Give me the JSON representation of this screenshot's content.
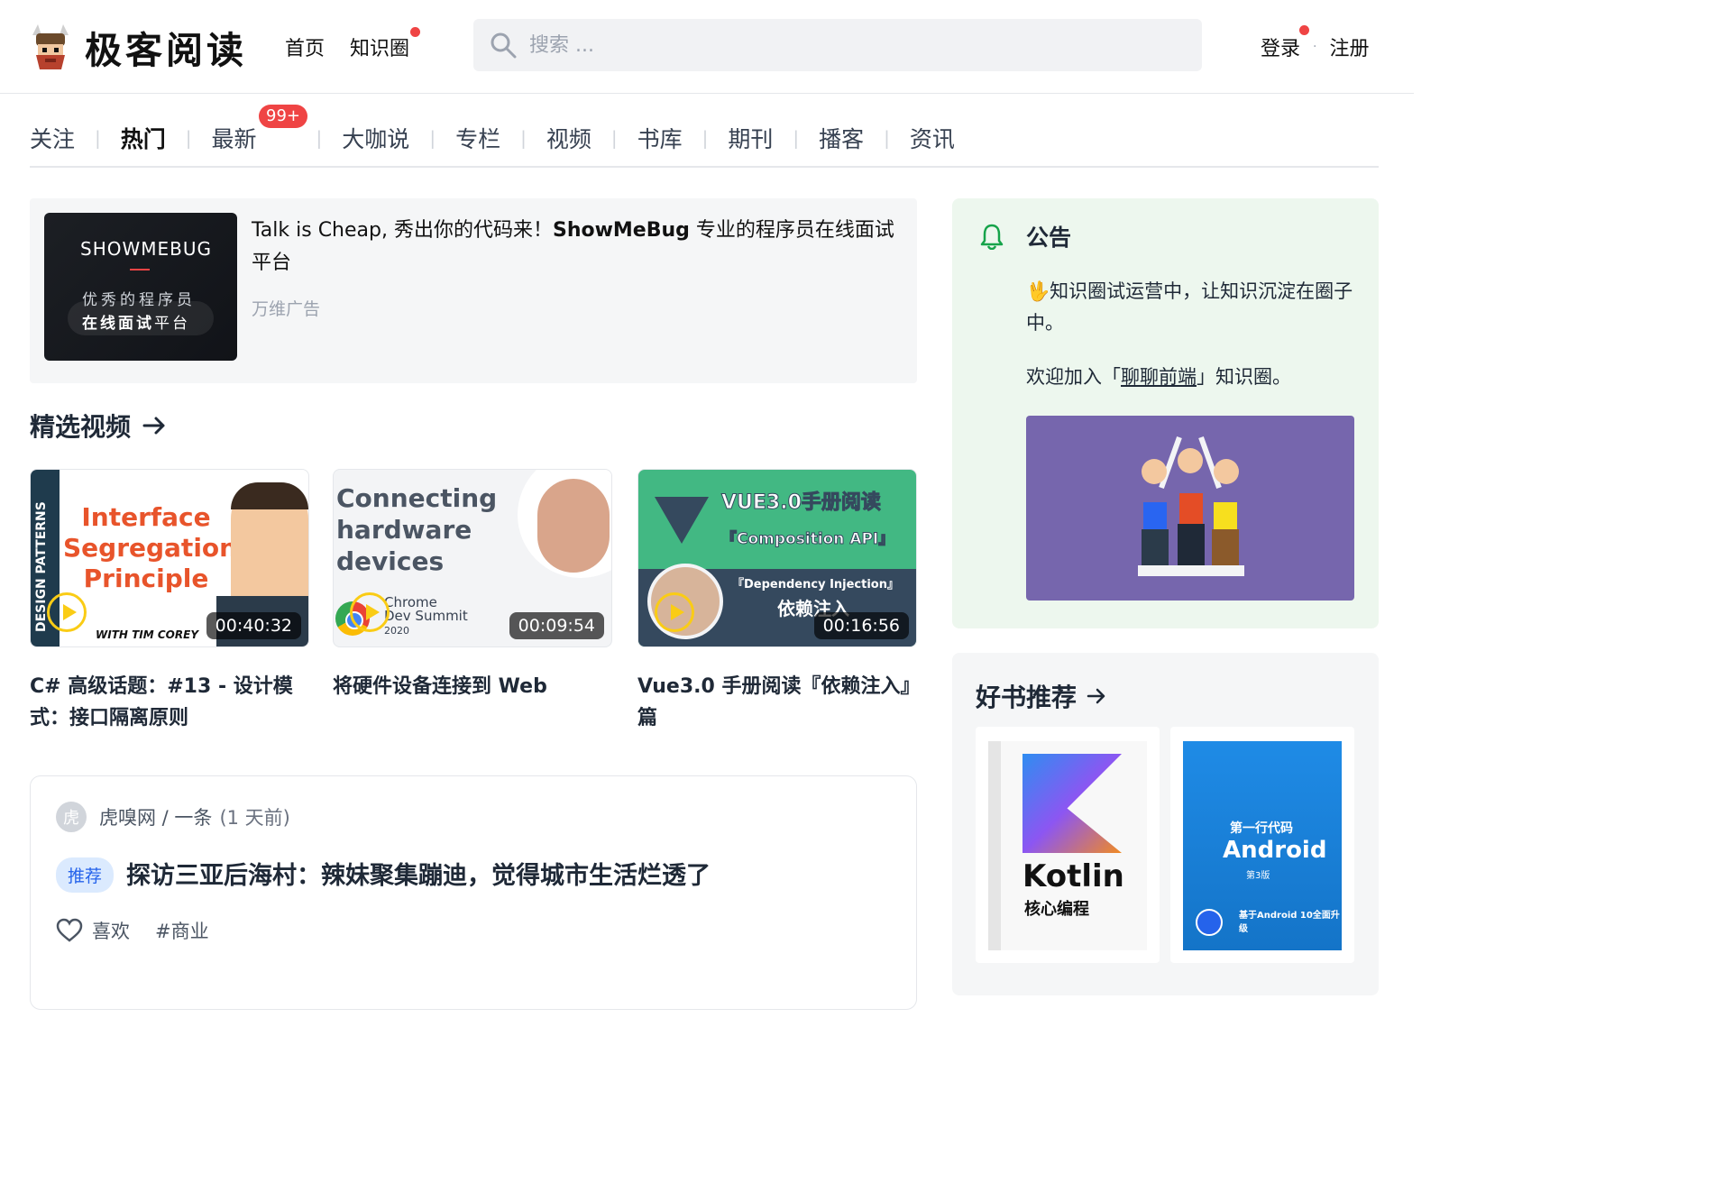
{
  "header": {
    "logo_text": "极客阅读",
    "nav": [
      "首页",
      "知识圈"
    ],
    "search_placeholder": "搜索 ...",
    "login": "登录",
    "register": "注册",
    "auth_sep": "·"
  },
  "tabs": {
    "items": [
      "关注",
      "热门",
      "最新",
      "大咖说",
      "专栏",
      "视频",
      "书库",
      "期刊",
      "播客",
      "资讯"
    ],
    "active": "热门",
    "badge": "99+"
  },
  "ad": {
    "brand": "SHOWMEBUG",
    "line1": "优秀的程序员",
    "line2_bold": "在线面试",
    "line2_rest": "平台",
    "text_a": "Talk is Cheap, 秀出你的代码来！",
    "text_b": "ShowMeBug",
    "text_c": " 专业的程序员在线面试平台",
    "source": "万维广告"
  },
  "videos": {
    "section_title": "精选视频",
    "items": [
      {
        "title": "C# 高级话题：#13 - 设计模式：接口隔离原则",
        "duration": "00:40:32",
        "thumb_side": "DESIGN PATTERNS",
        "thumb_title": "Interface Segregation Principle",
        "thumb_by": "WITH TIM COREY"
      },
      {
        "title": "将硬件设备连接到 Web",
        "duration": "00:09:54",
        "thumb_title": "Connecting hardware devices",
        "thumb_sub1": "Chrome",
        "thumb_sub2": "Dev Summit",
        "thumb_sub3": "2020"
      },
      {
        "title": "Vue3.0 手册阅读『依赖注入』篇",
        "duration": "00:16:56",
        "thumb_t1": "VUE3.0手册阅读",
        "thumb_t2": "『Composition API』",
        "thumb_t3": "『Dependency Injection』",
        "thumb_t4": "依赖注入"
      }
    ]
  },
  "feed": {
    "avatar_char": "虎",
    "source": "虎嗅网 / 一条",
    "time": "(1 天前)",
    "tag_recommend": "推荐",
    "title": "探访三亚后海村：辣妹聚集蹦迪，觉得城市生活烂透了",
    "like": "喜欢",
    "topic": "#商业"
  },
  "notice": {
    "title": "公告",
    "p1_emoji": "🖖",
    "p1": "知识圈试运营中，让知识沉淀在圈子中。",
    "p2_a": "欢迎加入「",
    "p2_link": "聊聊前端",
    "p2_b": "」知识圈。"
  },
  "books": {
    "section_title": "好书推荐",
    "items": [
      {
        "cover_title": "Kotlin",
        "cover_sub": "核心编程"
      },
      {
        "cover_top": "第一行代码",
        "cover_title": "Android",
        "cover_ed": "第3版",
        "cover_note": "基于Android 10全面升级"
      }
    ]
  },
  "colors": {
    "accent_green": "#6ee7b7",
    "badge_red": "#ef4444",
    "notice_bg": "#edf7ee",
    "vue_green": "#42b883"
  }
}
